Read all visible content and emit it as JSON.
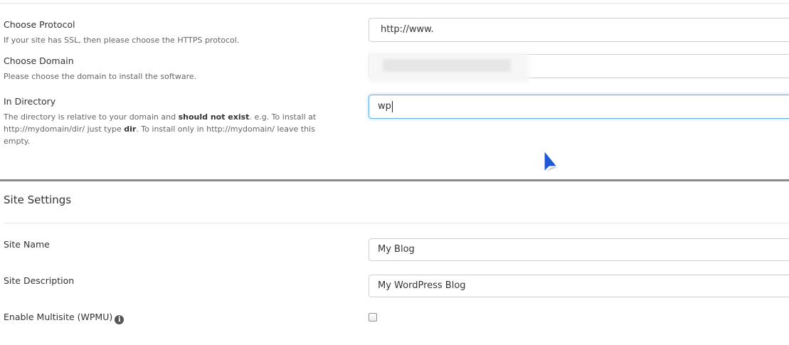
{
  "install_location": {
    "protocol": {
      "label": "Choose Protocol",
      "help": "If your site has SSL, then please choose the HTTPS protocol.",
      "value": "http://www."
    },
    "domain": {
      "label": "Choose Domain",
      "help": "Please choose the domain to install the software."
    },
    "directory": {
      "label": "In Directory",
      "help_part1": "The directory is relative to your domain and ",
      "help_bold1": "should not exist",
      "help_part2": ". e.g. To install at http://mydomain/dir/ just type ",
      "help_bold2": "dir",
      "help_part3": ". To install only in http://mydomain/ leave this empty.",
      "value": "wp"
    }
  },
  "site_settings": {
    "title": "Site Settings",
    "site_name": {
      "label": "Site Name",
      "value": "My Blog"
    },
    "site_description": {
      "label": "Site Description",
      "value": "My WordPress Blog"
    },
    "multisite": {
      "label": "Enable Multisite (WPMU)",
      "info_icon": "info-circle-icon",
      "checked": false
    }
  },
  "colors": {
    "focus_border": "#66afe9",
    "cursor": "#2b5fd9"
  }
}
